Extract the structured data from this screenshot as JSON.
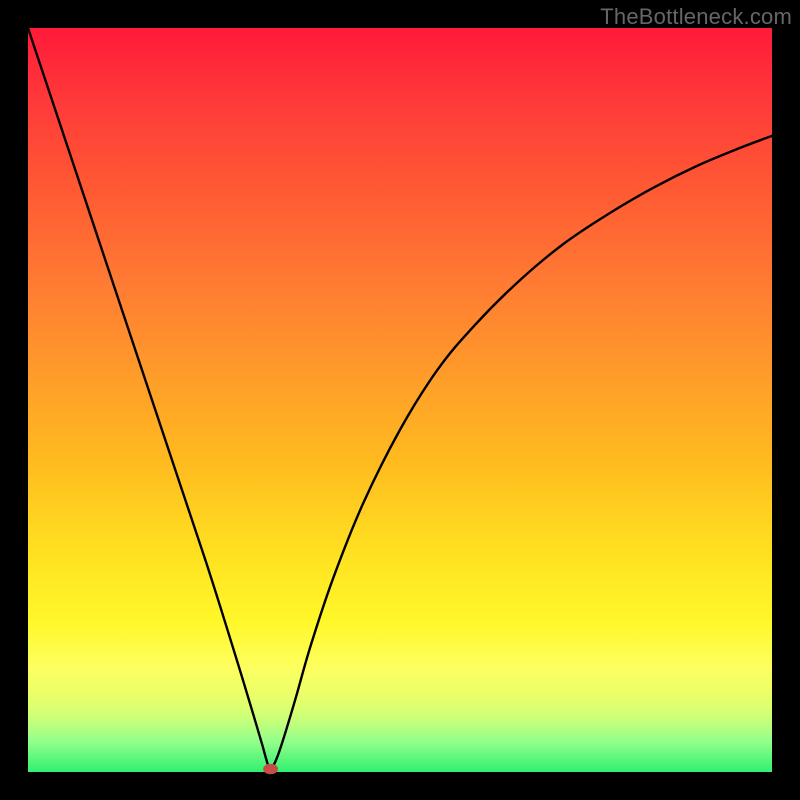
{
  "watermark": "TheBottleneck.com",
  "chart_data": {
    "type": "line",
    "title": "",
    "xlabel": "",
    "ylabel": "",
    "xlim": [
      0,
      100
    ],
    "ylim": [
      0,
      100
    ],
    "grid": false,
    "legend": false,
    "series": [
      {
        "name": "curve",
        "color": "#000000",
        "x": [
          0,
          2,
          5,
          8,
          12,
          16,
          20,
          24,
          27,
          29,
          30.5,
          31.5,
          32,
          32.4,
          32.8,
          33.5,
          34.5,
          36,
          38,
          41,
          45,
          50,
          55,
          60,
          66,
          72,
          78,
          84,
          90,
          96,
          100
        ],
        "values": [
          100,
          94,
          85,
          76,
          64,
          52,
          40,
          28,
          18.5,
          12,
          7,
          3.6,
          1.8,
          0.6,
          0.6,
          2,
          5,
          10,
          17,
          26,
          36,
          46,
          54,
          60,
          66,
          71,
          75,
          78.5,
          81.5,
          84,
          85.5
        ]
      }
    ],
    "marker": {
      "x": 32.6,
      "y": 0.4,
      "color": "#c94d47",
      "radius": 1.0
    }
  }
}
